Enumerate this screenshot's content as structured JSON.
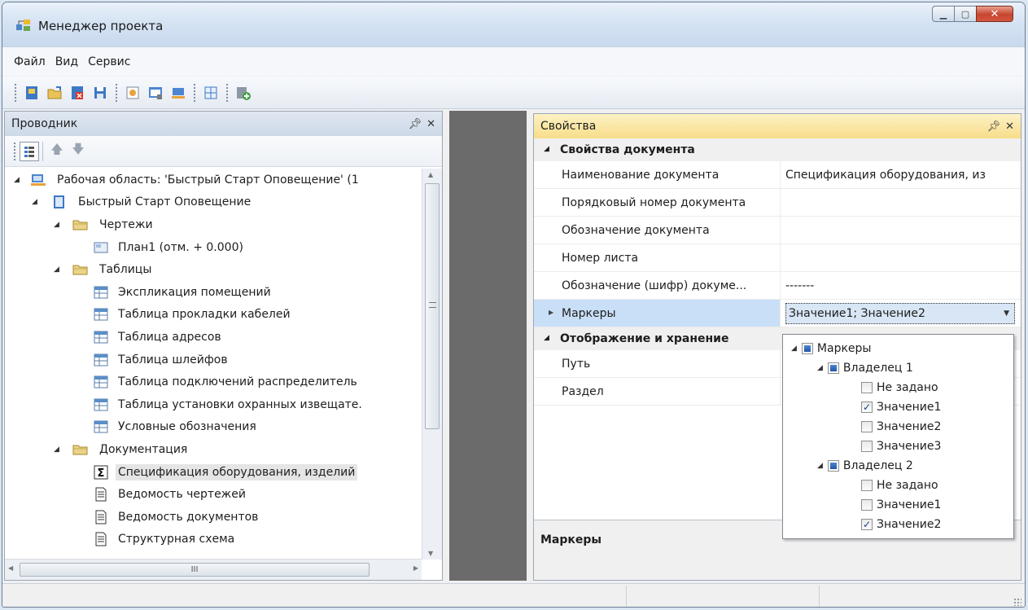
{
  "window": {
    "title": "Менеджер проекта"
  },
  "menu": [
    "Файл",
    "Вид",
    "Сервис"
  ],
  "explorer": {
    "title": "Проводник",
    "tree": [
      {
        "label": "Рабочая область: 'Быстрый Старт Оповещение' (1",
        "level": 0,
        "icon": "workspace-icon",
        "expanded": true
      },
      {
        "label": "Быстрый Старт Оповещение",
        "level": 1,
        "icon": "project-icon",
        "expanded": true
      },
      {
        "label": "Чертежи",
        "level": 2,
        "icon": "folder-icon",
        "expanded": true
      },
      {
        "label": "План1 (отм. + 0.000)",
        "level": 3,
        "icon": "plan-icon"
      },
      {
        "label": "Таблицы",
        "level": 2,
        "icon": "folder-icon",
        "expanded": true
      },
      {
        "label": "Экспликация помещений",
        "level": 3,
        "icon": "table-icon"
      },
      {
        "label": "Таблица прокладки кабелей",
        "level": 3,
        "icon": "table-icon"
      },
      {
        "label": "Таблица адресов",
        "level": 3,
        "icon": "table-icon"
      },
      {
        "label": "Таблица шлейфов",
        "level": 3,
        "icon": "table-icon"
      },
      {
        "label": "Таблица подключений распределитель",
        "level": 3,
        "icon": "table-icon"
      },
      {
        "label": "Таблица установки охранных извещате.",
        "level": 3,
        "icon": "table-icon"
      },
      {
        "label": "Условные обозначения",
        "level": 3,
        "icon": "table-icon"
      },
      {
        "label": "Документация",
        "level": 2,
        "icon": "folder-icon",
        "expanded": true
      },
      {
        "label": "Спецификация оборудования, изделий",
        "level": 3,
        "icon": "sigma-icon",
        "selected": true
      },
      {
        "label": "Ведомость чертежей",
        "level": 3,
        "icon": "document-icon"
      },
      {
        "label": "Ведомость документов",
        "level": 3,
        "icon": "document-icon"
      },
      {
        "label": "Структурная схема",
        "level": 3,
        "icon": "document-icon"
      }
    ],
    "hscroll_thumb_text": "III"
  },
  "properties": {
    "title": "Свойства",
    "groups": [
      {
        "name": "Свойства документа",
        "rows": [
          {
            "name": "Наименование документа",
            "value": "Спецификация оборудования, из"
          },
          {
            "name": "Порядковый номер документа",
            "value": ""
          },
          {
            "name": "Обозначение документа",
            "value": ""
          },
          {
            "name": "Номер листа",
            "value": ""
          },
          {
            "name": "Обозначение (шифр) докуме...",
            "value": "-------"
          },
          {
            "name": "Маркеры",
            "value": "Значение1; Значение2",
            "highlighted": true,
            "combo": true
          }
        ]
      },
      {
        "name": "Отображение и хранение",
        "rows": [
          {
            "name": "Путь",
            "value": ""
          },
          {
            "name": "Раздел",
            "value": ""
          }
        ]
      }
    ],
    "description_title": "Маркеры"
  },
  "dropdown": {
    "items": [
      {
        "label": "Маркеры",
        "level": 0,
        "state": "partial",
        "toggle": true
      },
      {
        "label": "Владелец 1",
        "level": 1,
        "state": "partial",
        "toggle": true
      },
      {
        "label": "Не задано",
        "level": 2,
        "state": "unchecked"
      },
      {
        "label": "Значение1",
        "level": 2,
        "state": "checked"
      },
      {
        "label": "Значение2",
        "level": 2,
        "state": "unchecked"
      },
      {
        "label": "Значение3",
        "level": 2,
        "state": "unchecked"
      },
      {
        "label": "Владелец 2",
        "level": 1,
        "state": "partial",
        "toggle": true
      },
      {
        "label": "Не задано",
        "level": 2,
        "state": "unchecked"
      },
      {
        "label": "Значение1",
        "level": 2,
        "state": "unchecked"
      },
      {
        "label": "Значение2",
        "level": 2,
        "state": "checked"
      }
    ]
  },
  "icons": {
    "pin": "pin-icon",
    "close": "close-icon",
    "check_mark": "✓"
  }
}
